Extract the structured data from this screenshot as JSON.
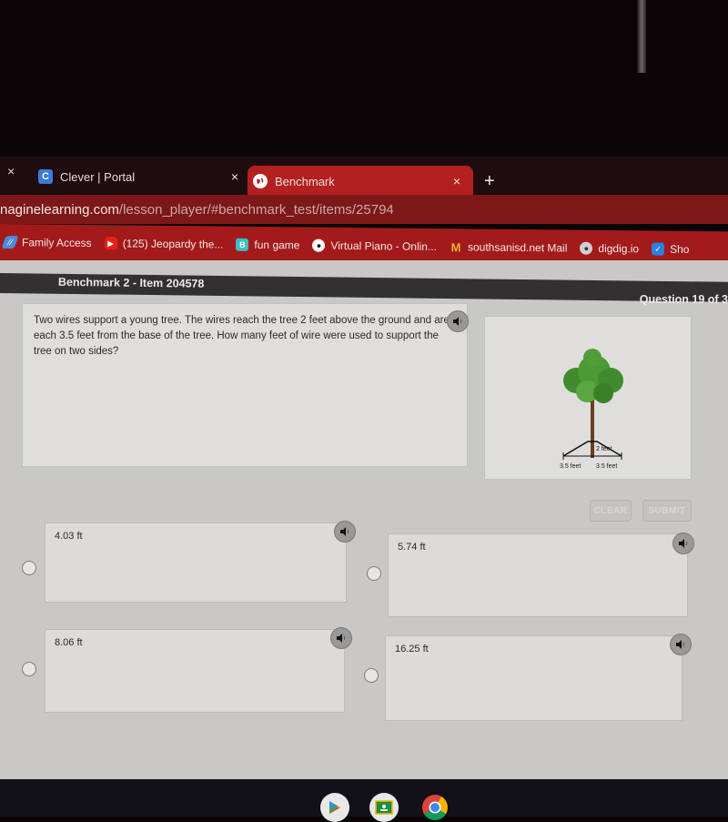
{
  "browser": {
    "tabs": [
      {
        "title": "Clever | Portal",
        "icon": "clever-c-icon",
        "favicon_letter": "C",
        "active": false
      },
      {
        "title": "Benchmark",
        "icon": "globe-icon",
        "active": true
      }
    ],
    "close_glyph": "×",
    "new_tab_glyph": "+",
    "url_host": "naginelearning.com",
    "url_path": "/lesson_player/#benchmark_test/items/25794",
    "bookmarks": [
      {
        "label": "Family Access",
        "icon": "family-access-icon",
        "glyph": "//"
      },
      {
        "label": "(125) Jeopardy the...",
        "icon": "youtube-icon",
        "glyph": "▶"
      },
      {
        "label": "fun game",
        "icon": "b-letter-icon",
        "glyph": "B"
      },
      {
        "label": "Virtual Piano - Onlin...",
        "icon": "panda-icon",
        "glyph": "●"
      },
      {
        "label": "southsanisd.net Mail",
        "icon": "gmail-icon",
        "glyph": "M"
      },
      {
        "label": "digdig.io",
        "icon": "digdig-icon",
        "glyph": "●"
      },
      {
        "label": "Sho",
        "icon": "checkmark-icon",
        "glyph": "✓"
      }
    ],
    "colors": {
      "accent": "#b3201f",
      "omnibox": "#7e1818",
      "bookmarks_bar": "#a31a1b"
    }
  },
  "assessment": {
    "title": "Benchmark 2 - Item 204578",
    "question_counter": "Question 19 of 3",
    "question_text": "Two wires support a young tree. The wires reach the tree 2 feet above the ground and are each 3.5 feet from the base of the tree. How many feet of wire were used to support the tree on two sides?",
    "figure": {
      "height_label": "2 feet",
      "left_base_label": "3.5 feet",
      "right_base_label": "3.5 feet"
    },
    "buttons": {
      "clear": "CLEAR",
      "submit": "SUBMIT"
    },
    "choices": [
      {
        "label": "4.03 ft",
        "selected": false
      },
      {
        "label": "5.74 ft",
        "selected": false
      },
      {
        "label": "8.06 ft",
        "selected": false
      },
      {
        "label": "16.25 ft",
        "selected": false
      }
    ]
  },
  "taskbar": {
    "apps": [
      {
        "name": "Play Store",
        "icon": "play-store-icon"
      },
      {
        "name": "Google Classroom",
        "icon": "classroom-icon"
      },
      {
        "name": "Chrome",
        "icon": "chrome-icon"
      }
    ]
  }
}
